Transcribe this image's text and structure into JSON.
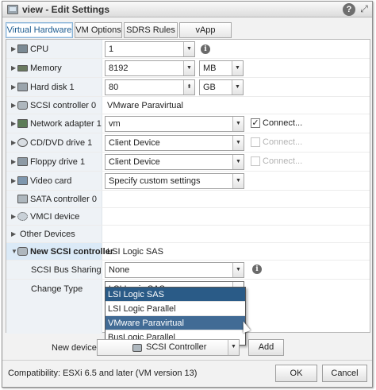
{
  "window": {
    "title": "view - Edit Settings",
    "help": "?",
    "expand": "⤢"
  },
  "tabs": [
    {
      "label": "Virtual Hardware",
      "active": true
    },
    {
      "label": "VM Options"
    },
    {
      "label": "SDRS Rules"
    },
    {
      "label": "vApp Options"
    }
  ],
  "hardware": {
    "cpu": {
      "label": "CPU",
      "value": "1"
    },
    "memory": {
      "label": "Memory",
      "value": "8192",
      "unit": "MB"
    },
    "hard_disk": {
      "label": "Hard disk 1",
      "value": "80",
      "unit": "GB"
    },
    "scsi0": {
      "label": "SCSI controller 0",
      "value": "VMware Paravirtual"
    },
    "network": {
      "label": "Network adapter 1",
      "value": "vm",
      "connect_label": "Connect...",
      "connected": true
    },
    "cdrom": {
      "label": "CD/DVD drive 1",
      "value": "Client Device",
      "connect_label": "Connect...",
      "connected": false
    },
    "floppy": {
      "label": "Floppy drive 1",
      "value": "Client Device",
      "connect_label": "Connect...",
      "connected": false
    },
    "video": {
      "label": "Video card",
      "value": "Specify custom settings"
    },
    "sata": {
      "label": "SATA controller 0"
    },
    "vmci": {
      "label": "VMCI device"
    },
    "other": {
      "label": "Other Devices"
    },
    "new_scsi": {
      "label": "New SCSI controller",
      "value": "LSI Logic SAS",
      "bus_sharing_label": "SCSI Bus Sharing",
      "bus_sharing_value": "None",
      "change_type_label": "Change Type",
      "change_type_value": "LSI Logic SAS",
      "options": [
        "LSI Logic SAS",
        "LSI Logic Parallel",
        "VMware Paravirtual",
        "BusLogic Parallel"
      ]
    }
  },
  "new_device": {
    "label": "New device:",
    "value": "SCSI Controller",
    "add_label": "Add"
  },
  "footer": {
    "compatibility": "Compatibility: ESXi 6.5 and later (VM version 13)",
    "ok": "OK",
    "cancel": "Cancel"
  },
  "colors": {
    "accent": "#2a5b87",
    "hover": "#416b95",
    "label_bg": "#eef2f6",
    "new_row_bg": "#dbeaf7"
  }
}
